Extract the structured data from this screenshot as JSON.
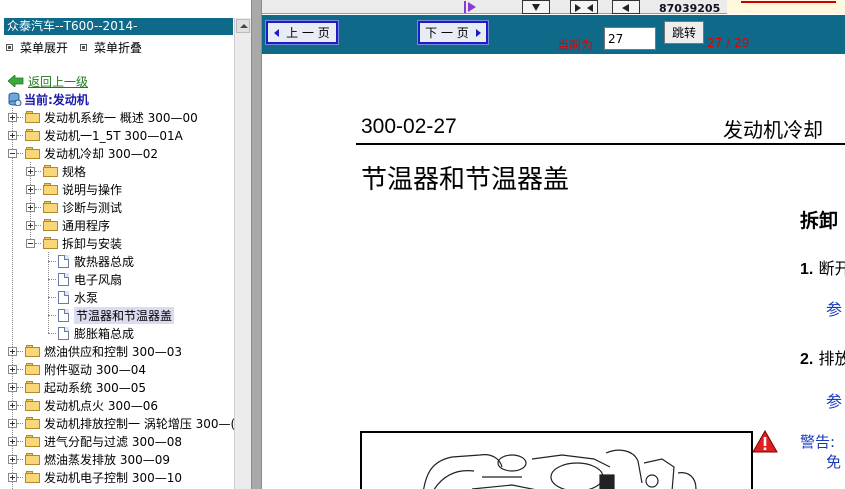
{
  "app": {
    "title": "众泰汽车--T600--2014-",
    "top_number": "87039205"
  },
  "menu": {
    "expand": "菜单展开",
    "collapse": "菜单折叠"
  },
  "tree": {
    "back": "返回上一级",
    "current": "当前:发动机",
    "items": [
      "发动机系统一 概述 300—00",
      "发动机一1_5T 300—01A",
      "发动机冷却 300—02",
      "规格",
      "说明与操作",
      "诊断与测试",
      "通用程序",
      "拆卸与安装",
      "散热器总成",
      "电子风扇",
      "水泵",
      "节温器和节温器盖",
      "膨胀箱总成",
      "燃油供应和控制 300—03",
      "附件驱动 300—04",
      "起动系统 300—05",
      "发动机点火 300—06",
      "发动机排放控制一 涡轮增压 300—(",
      "进气分配与过滤 300—08",
      "燃油蒸发排放 300—09",
      "发动机电子控制 300—10"
    ]
  },
  "nav": {
    "prev": "上 一 页",
    "next": "下 一 页",
    "current_label": "当前为",
    "page_value": "27",
    "jump": "跳转",
    "page_count": "27 / 29"
  },
  "document": {
    "code": "300-02-27",
    "section": "发动机冷却",
    "heading": "节温器和节温器盖",
    "remove": "拆卸",
    "step1_num": "1.",
    "step1_text": "断开",
    "ref1": "参",
    "step2_num": "2.",
    "step2_text": "排放",
    "ref2": "参",
    "warning": "警告:",
    "warning_line2": "免"
  },
  "colors": {
    "nav_bar": "#0f6a8a",
    "nav_button_border": "#1c1cc8",
    "page_text_red": "#e00000",
    "link_blue": "#1a3ab8",
    "tree_current": "#1a1aa8",
    "back_link": "#207a20"
  }
}
